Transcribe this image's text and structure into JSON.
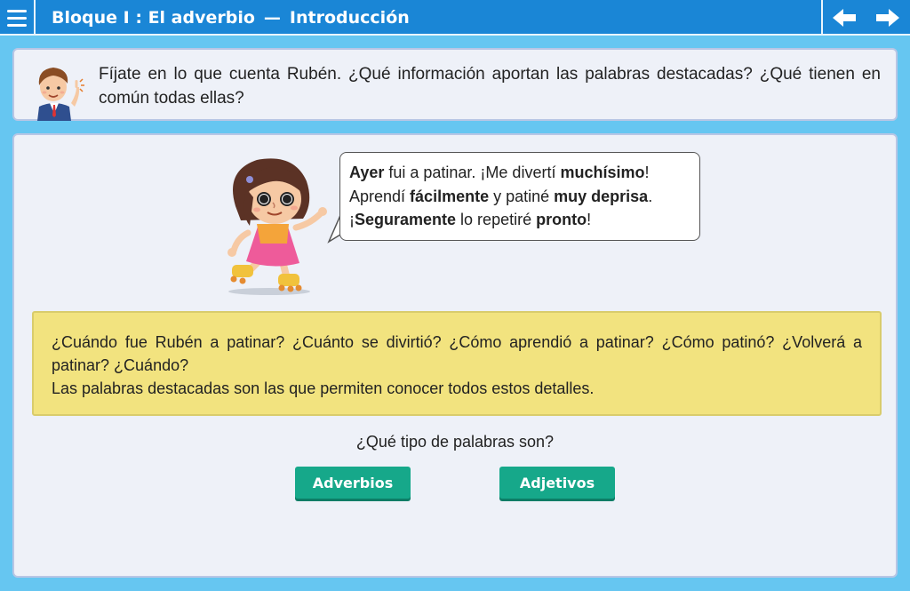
{
  "header": {
    "menu_icon": "hamburger-icon",
    "title": "Bloque I : El adverbio",
    "separator": "—",
    "subtitle": "Introducción",
    "prev_icon": "arrow-left-icon",
    "next_icon": "arrow-right-icon",
    "bar_color": "#1a86d6"
  },
  "instruction": {
    "text": "Fíjate en lo que cuenta Rubén. ¿Qué información aportan las palabras destacadas? ¿Qué tienen en común todas ellas?"
  },
  "speech": {
    "l1": {
      "b1": "Ayer",
      "t1": " fui a patinar. ¡Me divertí ",
      "b2": "muchísimo",
      "t2": "!"
    },
    "l2": {
      "t1": "Aprendí ",
      "b1": "fácilmente",
      "t2": " y patiné ",
      "b2": "muy deprisa",
      "t3": "."
    },
    "l3": {
      "t1": "¡",
      "b1": "Seguramente",
      "t2": " lo repetiré ",
      "b2": "pronto",
      "t3": "!"
    }
  },
  "info": {
    "questions": "¿Cuándo fue Rubén a patinar? ¿Cuánto se divirtió? ¿Cómo aprendió a patinar? ¿Cómo patinó? ¿Volverá a patinar? ¿Cuándo?",
    "conclusion": "Las palabras destacadas son las que permiten conocer todos estos detalles.",
    "background": "#f2e37f"
  },
  "quiz": {
    "question": "¿Qué tipo de palabras son?",
    "options": [
      "Adverbios",
      "Adjetivos"
    ],
    "button_color": "#16a88a"
  }
}
